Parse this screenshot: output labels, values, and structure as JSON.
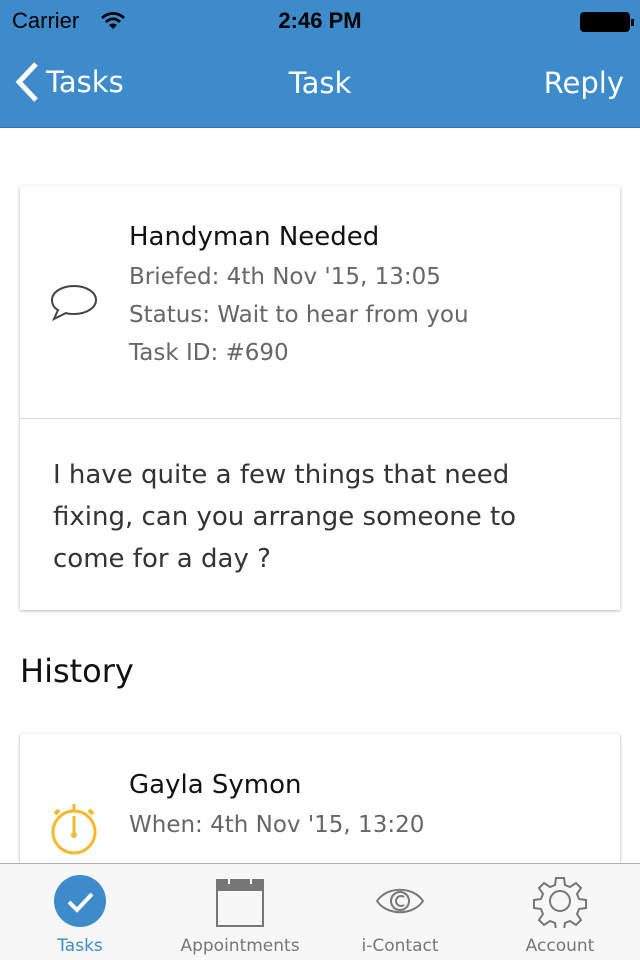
{
  "status_bar": {
    "carrier": "Carrier",
    "time": "2:46 PM"
  },
  "nav": {
    "back_label": "Tasks",
    "title": "Task",
    "reply_label": "Reply"
  },
  "task": {
    "title": "Handyman Needed",
    "briefed": "Briefed: 4th Nov '15, 13:05",
    "status": "Status: Wait to hear from you",
    "task_id": "Task ID: #690",
    "message": "I have quite a few things that need fixing, can you arrange someone to come for a day ?",
    "icon": "speech-bubble-icon"
  },
  "history": {
    "heading": "History",
    "items": [
      {
        "name": "Gayla Symon",
        "when": "When: 4th Nov '15, 13:20",
        "icon": "stopwatch-icon"
      }
    ]
  },
  "tabs": [
    {
      "label": "Tasks",
      "icon": "check-circle-icon",
      "active": true
    },
    {
      "label": "Appointments",
      "icon": "calendar-icon"
    },
    {
      "label": "i-Contact",
      "icon": "eye-icon"
    },
    {
      "label": "Account",
      "icon": "gear-icon"
    }
  ],
  "colors": {
    "accent": "#3d8bcb",
    "history_icon": "#f5b82e"
  }
}
